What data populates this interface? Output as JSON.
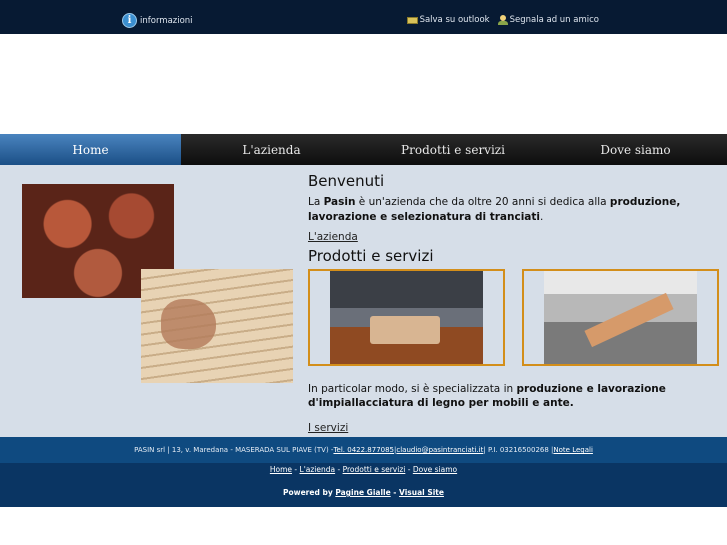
{
  "topbar": {
    "info_label": "informazioni",
    "outlook_label": "Salva su outlook",
    "friend_label": "Segnala ad un amico"
  },
  "nav": {
    "home": "Home",
    "azienda": "L'azienda",
    "prodotti": "Prodotti e servizi",
    "dove": "Dove siamo"
  },
  "welcome": {
    "title": "Benvenuti",
    "p1": "La ",
    "brand": "Pasin",
    "p2": " è un'azienda che da oltre 20 anni si dedica alla ",
    "p3": "produzione, lavorazione e selezionatura di tranciati",
    "p4": ".",
    "link": "L'azienda"
  },
  "services": {
    "title": "Prodotti e servizi",
    "t1": "In particolar modo, si è specializzata in ",
    "t2": "produzione e lavorazione d'impiallacciatura di legno per mobili e ante.",
    "link": "I servizi"
  },
  "footer": {
    "company": "PASIN srl | 13, v. Maredana - MASERADA SUL PIAVE (TV) - ",
    "tel": "Tel. 0422.877085",
    "sep1": " | ",
    "email": "claudio@pasintranciati.it",
    "piva": " | P.I. 03216500268 | ",
    "legal": "Note Legali",
    "nav_home": "Home",
    "nav_azienda": "L'azienda",
    "nav_prodotti": "Prodotti e servizi",
    "nav_dove": "Dove siamo",
    "dash": " - ",
    "powered_prefix": "Powered by ",
    "pagine": "Pagine Gialle",
    "visual": "Visual Site"
  },
  "colors": {
    "topbar": "#071a33",
    "nav_active": "#2e6aa8",
    "content_bg": "#d6dee8",
    "frame": "#d38e1a",
    "footer": "#0f4a80"
  }
}
